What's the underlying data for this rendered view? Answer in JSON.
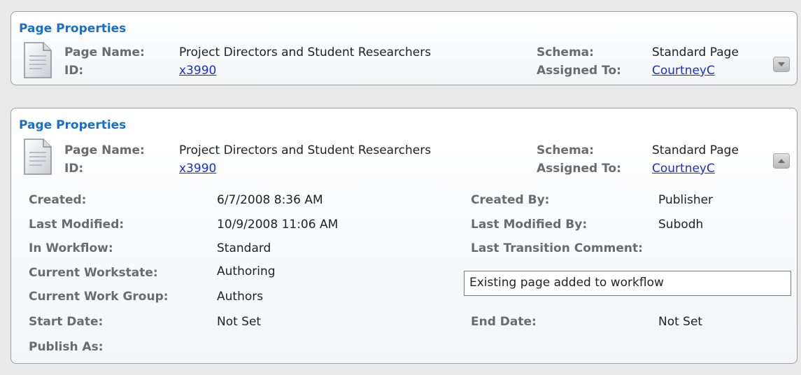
{
  "panels": [
    {
      "title": "Page Properties",
      "page_name_label": "Page Name:",
      "page_name": "Project Directors and Student Researchers",
      "id_label": "ID:",
      "id": "x3990",
      "schema_label": "Schema:",
      "schema": "Standard Page",
      "assigned_label": "Assigned To:",
      "assigned_to": "CourtneyC",
      "toggle_icon": "chevron-down-icon"
    },
    {
      "title": "Page Properties",
      "page_name_label": "Page Name:",
      "page_name": "Project Directors and Student Researchers",
      "id_label": "ID:",
      "id": "x3990",
      "schema_label": "Schema:",
      "schema": "Standard Page",
      "assigned_label": "Assigned To:",
      "assigned_to": "CourtneyC",
      "toggle_icon": "chevron-up-icon"
    }
  ],
  "details": {
    "created_label": "Created:",
    "created": "6/7/2008 8:36 AM",
    "last_modified_label": "Last Modified:",
    "last_modified": "10/9/2008 11:06 AM",
    "in_workflow_label": "In Workflow:",
    "in_workflow": "Standard",
    "current_workstate_label": "Current Workstate:",
    "current_workstate": "Authoring",
    "current_work_group_label": "Current Work Group:",
    "current_work_group": "Authors",
    "start_date_label": "Start Date:",
    "start_date": "Not Set",
    "publish_as_label": "Publish As:",
    "created_by_label": "Created By:",
    "created_by": "Publisher",
    "last_modified_by_label": "Last Modified By:",
    "last_modified_by": "Subodh",
    "last_transition_comment_label": "Last Transition Comment:",
    "last_transition_comment": "Existing page added to workflow",
    "end_date_label": "End Date:",
    "end_date": "Not Set"
  }
}
